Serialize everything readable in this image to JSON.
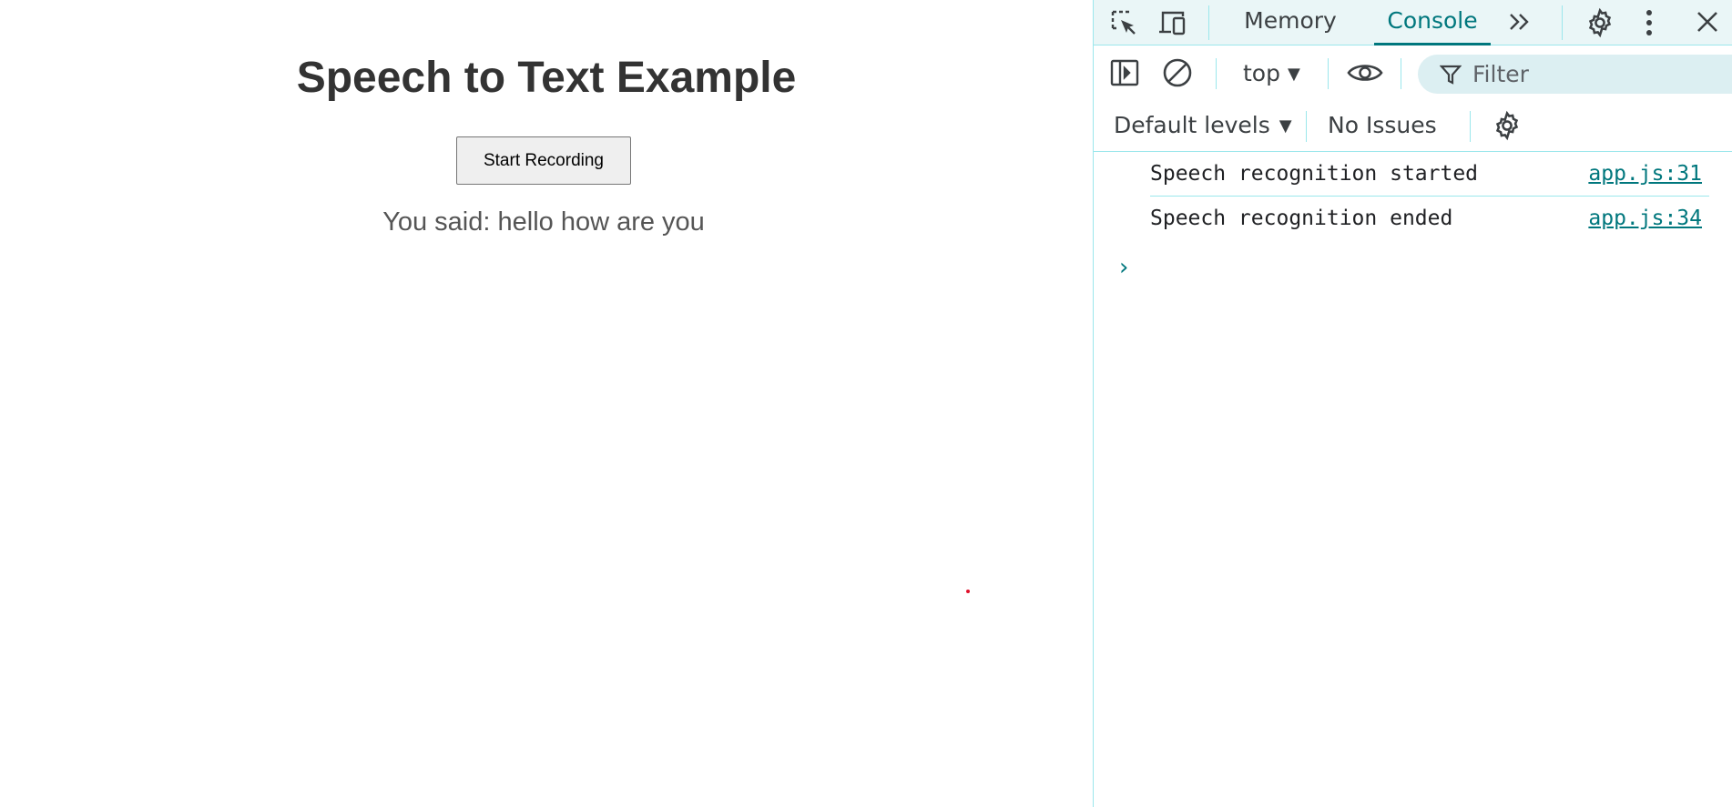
{
  "page": {
    "title": "Speech to Text Example",
    "button_label": "Start Recording",
    "result_text": "You said: hello how are you"
  },
  "devtools": {
    "tabs": [
      {
        "label": "Memory",
        "active": false
      },
      {
        "label": "Console",
        "active": true
      }
    ],
    "icons": {
      "inspect": "inspect-element-icon",
      "device": "device-toolbar-icon",
      "more_tabs": "more-tabs-icon",
      "settings": "settings-gear-icon",
      "menu": "kebab-menu-icon",
      "close": "close-icon",
      "sidebar": "sidebar-toggle-icon",
      "clear": "clear-console-icon",
      "eye": "live-expression-eye-icon",
      "filter": "filter-funnel-icon"
    },
    "context": "top",
    "filter_placeholder": "Filter",
    "levels": "Default levels",
    "issues": "No Issues",
    "logs": [
      {
        "message": "Speech recognition started",
        "source": "app.js:31"
      },
      {
        "message": "Speech recognition ended",
        "source": "app.js:34"
      }
    ],
    "prompt_glyph": "›"
  },
  "colors": {
    "accent": "#00777d",
    "panel_border": "#9be7ec",
    "tabbar_bg": "#eaf6f7",
    "filter_bg": "#dceff2"
  }
}
